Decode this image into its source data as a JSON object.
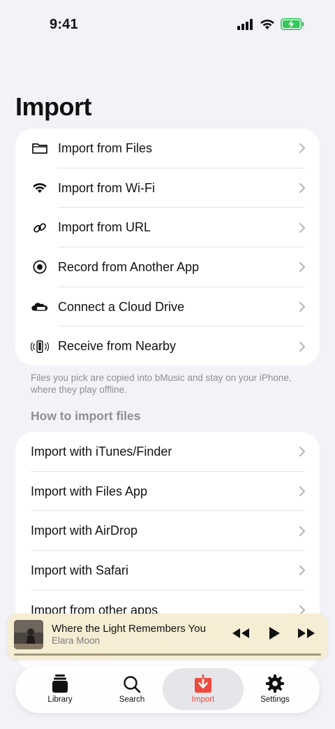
{
  "status_bar": {
    "time": "9:41"
  },
  "page": {
    "title": "Import"
  },
  "import_options": [
    {
      "label": "Import from Files",
      "icon": "folder-icon"
    },
    {
      "label": "Import from Wi-Fi",
      "icon": "wifi-icon"
    },
    {
      "label": "Import from URL",
      "icon": "link-icon"
    },
    {
      "label": "Record from Another App",
      "icon": "record-icon"
    },
    {
      "label": "Connect a Cloud Drive",
      "icon": "cloud-drive-icon"
    },
    {
      "label": "Receive from Nearby",
      "icon": "nearby-phone-icon"
    }
  ],
  "footnote": "Files you pick are copied into bMusic and stay on your iPhone, where they play offline.",
  "how_to": {
    "header": "How to import files",
    "items": [
      {
        "label": "Import with iTunes/Finder"
      },
      {
        "label": "Import with Files App"
      },
      {
        "label": "Import with AirDrop"
      },
      {
        "label": "Import with Safari"
      },
      {
        "label": "Import from other apps"
      },
      {
        "label": ""
      }
    ]
  },
  "mini_player": {
    "title": "Where the Light Remembers You",
    "artist": "Elara Moon",
    "progress": 1.0
  },
  "tab_bar": {
    "tabs": [
      {
        "label": "Library",
        "icon": "library-icon"
      },
      {
        "label": "Search",
        "icon": "search-icon"
      },
      {
        "label": "Import",
        "icon": "import-icon",
        "active": true
      },
      {
        "label": "Settings",
        "icon": "gear-icon"
      }
    ]
  },
  "colors": {
    "accent": "#ee4b3f",
    "background": "#f2f2f7",
    "battery": "#34c759",
    "mini_player_bg": "#f5edd4"
  }
}
